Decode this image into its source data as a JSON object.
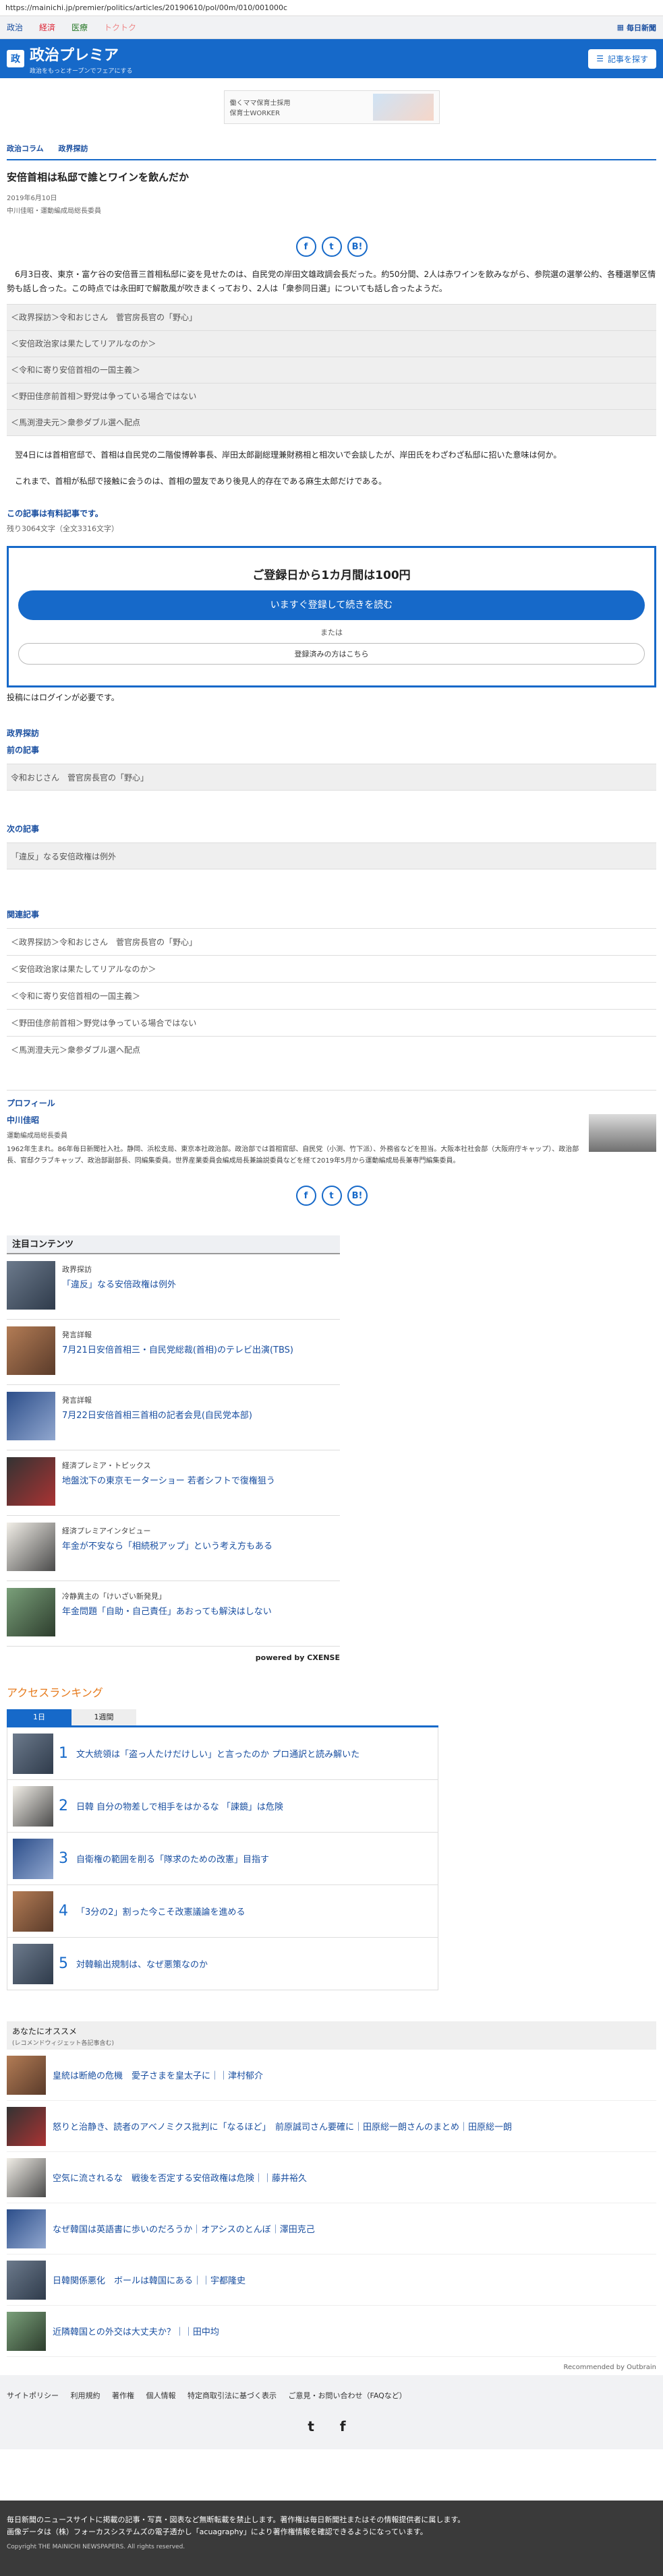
{
  "browser": {
    "url": "https://mainichi.jp/premier/politics/articles/20190610/pol/00m/010/001000c"
  },
  "topnav": {
    "links": [
      "政治",
      "経済",
      "医療",
      "トクトク"
    ],
    "mainichi": "毎日新聞"
  },
  "brand": {
    "title": "政治プレミア",
    "subtitle": "政治をもっとオープンでフェアにする",
    "search_label": "記事を探す",
    "logo_mark": "政"
  },
  "ad": {
    "line1": "働くママ保育士採用",
    "line2": "保育士WORKER"
  },
  "breadcrumb": [
    "政治コラム",
    "政界探訪"
  ],
  "article": {
    "headline": "安倍首相は私邸で誰とワインを飲んだか",
    "date": "2019年6月10日",
    "author": "中川佳昭・運動編成局総長委員",
    "lead": "6月3日夜、東京・富ケ谷の安倍晋三首相私邸に姿を見せたのは、自民党の岸田文雄政調会長だった。約50分間、2人は赤ワインを飲みながら、参院選の選挙公約、各種選挙区情勢も話し合った。この時点では永田町で解散風が吹きまくっており、2人は「衆参同日選」についても話し合ったようだ。",
    "inline_links": [
      "＜政界探訪＞令和おじさん　菅官房長官の「野心」",
      "＜安倍政治家は果たしてリアルなのか＞",
      "＜令和に寄り安倍首相の一国主義＞",
      "＜野田佳彦前首相＞野党は争っている場合ではない",
      "＜馬渕澄夫元＞衆参ダブル選へ配点"
    ],
    "body1": "翌4日には首相官邸で、首相は自民党の二階俊博幹事長、岸田太郎副総理兼財務相と相次いで会談したが、岸田氏をわざわざ私邸に招いた意味は何か。",
    "body2": "これまで、首相が私邸で接触に会うのは、首相の盟友であり後見人的存在である麻生太郎だけである。",
    "paid_label": "この記事は有料記事です。",
    "remaining": "残り3064文字（全文3316文字）"
  },
  "offer": {
    "title": "ご登録日から1カ月間は100円",
    "button": "いますぐ登録して続きを読む",
    "or": "または",
    "login": "登録済みの方はこちら"
  },
  "post_login": "投稿にはログインが必要です。",
  "series": {
    "label": "政界探訪",
    "prev_label": "前の記事",
    "prev_item": "令和おじさん　菅官房長官の「野心」",
    "next_label": "次の記事",
    "next_item": "「違反」なる安倍政権は例外"
  },
  "related": {
    "label": "関連記事",
    "items": [
      "＜政界探訪＞令和おじさん　菅官房長官の「野心」",
      "＜安倍政治家は果たしてリアルなのか＞",
      "＜令和に寄り安倍首相の一国主義＞",
      "＜野田佳彦前首相＞野党は争っている場合ではない",
      "＜馬渕澄夫元＞衆参ダブル選へ配点"
    ]
  },
  "profile": {
    "label": "プロフィール",
    "name": "中川佳昭",
    "role": "運動編成局総長委員",
    "bio": "1962年生まれ。86年毎日新聞社入社。静岡、浜松支局、東京本社政治部。政治部では首相官邸、自民党（小渕、竹下派）、外務省などを担当。大阪本社社会部（大阪府庁キャップ）、政治部長、官邸クラブキャップ、政治部副部長、同編集委員。世界産業委員会編成局長兼論説委員などを経て2019年5月から運動編成局長兼専門編集委員。"
  },
  "featured": {
    "title": "注目コンテンツ",
    "items": [
      {
        "cat": "政界探訪",
        "ttl": "「違反」なる安倍政権は例外"
      },
      {
        "cat": "発言詳報",
        "ttl": "7月21日安倍首相三・自民党総裁(首相)のテレビ出演(TBS)"
      },
      {
        "cat": "発言詳報",
        "ttl": "7月22日安倍首相三首相の記者会見(自民党本部)"
      },
      {
        "cat": "経済プレミア・トピックス",
        "ttl": "地盤沈下の東京モーターショー 若者シフトで復権狙う"
      },
      {
        "cat": "経済プレミアインタビュー",
        "ttl": "年金が不安なら「相続税アップ」という考え方もある"
      },
      {
        "cat": "冷静異主の「けいざい新発見」",
        "ttl": "年金問題「自助・自己責任」あおっても解決はしない"
      }
    ],
    "powered": "powered by CXENSE"
  },
  "ranking": {
    "title": "アクセスランキング",
    "tabs": [
      "1日",
      "1週間"
    ],
    "items": [
      {
        "num": "1",
        "text": "文大統領は「盗っ人たけだけしい」と言ったのか プロ通訳と読み解いた"
      },
      {
        "num": "2",
        "text": "日韓 自分の物差しで相手をはかるな 「諌鏡」は危険"
      },
      {
        "num": "3",
        "text": "自衛権の範囲を削る「隊求のための改憲」目指す"
      },
      {
        "num": "4",
        "text": "「3分の2」割った今こそ改憲議論を進める"
      },
      {
        "num": "5",
        "text": "対韓輸出規制は、なぜ悪策なのか"
      }
    ]
  },
  "recommend": {
    "title": "あなたにオススメ",
    "sub": "(レコメンドウィジェット各記事含む)",
    "items": [
      "皇統は断絶の危機　愛子さまを皇太子に｜｜津村郁介",
      "怒りと治静き、読者のアベノミクス批判に「なるほど」　前原誠司さん要確に｜田原総一朗さんのまとめ｜田原総一朗",
      "空気に流されるな　戦後を否定する安倍政権は危険｜｜藤井裕久",
      "なぜ韓国は英語書に歩いのだろうか｜オアシスのとんぼ｜澤田克己",
      "日韓関係悪化　ボールは韓国にある｜｜宇都隆史",
      "近隣韓国との外交は大丈夫か？｜｜田中均"
    ],
    "outbrain": "Recommended by Outbrain"
  },
  "footer": {
    "links": [
      "サイトポリシー",
      "利用規約",
      "著作権",
      "個人情報",
      "特定商取引法に基づく表示",
      "ご意見・お問い合わせ（FAQなど）"
    ],
    "social": [
      "twitter-icon",
      "facebook-icon"
    ],
    "notice1": "毎日新聞のニュースサイトに掲載の記事・写真・図表など無断転載を禁止します。著作権は毎日新聞社またはその情報提供者に属します。",
    "notice2": "画像データは（株）フォーカスシステムズの電子透かし「acuagraphy」により著作権情報を確認できるようになっています。",
    "copyright": "Copyright THE MAINICHI NEWSPAPERS. All rights reserved."
  }
}
